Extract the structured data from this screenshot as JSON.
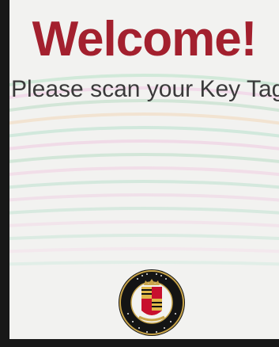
{
  "screen": {
    "heading": "Welcome!",
    "instruction": "Please scan your Key Tag"
  },
  "seal": {
    "icon": "county-seal-icon",
    "text_top": "ANNE ARUNDEL COUNTY",
    "text_bottom": "DEPARTMENT OF AGING & DISABILITIES"
  },
  "colors": {
    "heading": "#a3202e",
    "instruction": "#3a3a3a",
    "background": "#f2f2f0",
    "bezel": "#181818"
  }
}
